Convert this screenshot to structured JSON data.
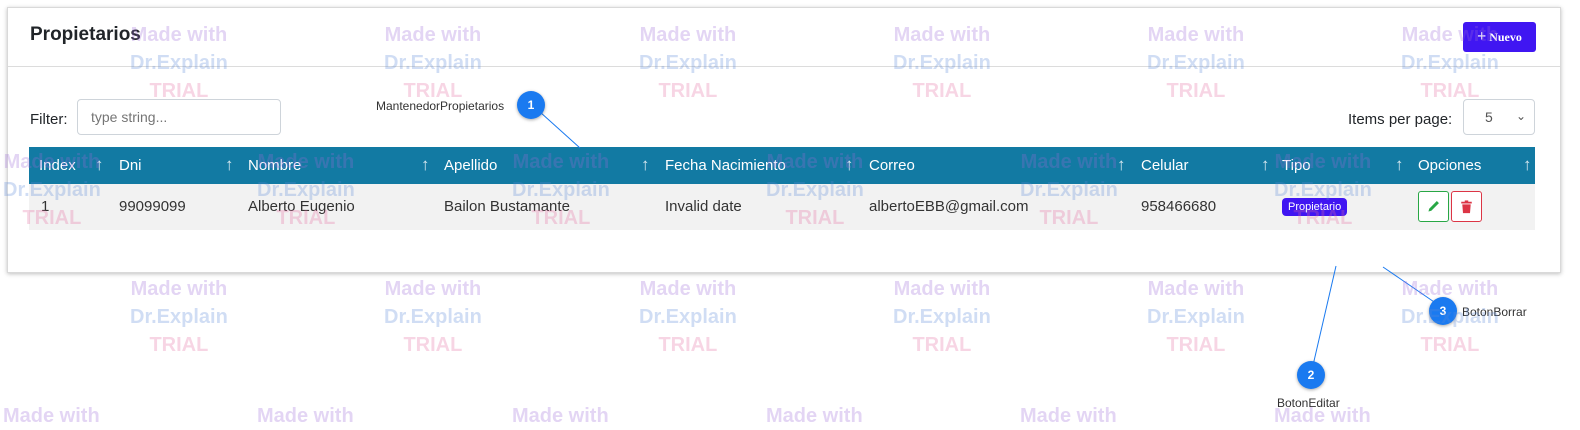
{
  "panel": {
    "title": "Propietarios",
    "new_button_label": "Nuevo",
    "new_button_icon": "plus-icon",
    "filter_label": "Filter:",
    "filter_placeholder": "type string...",
    "items_per_page_label": "Items per page:",
    "items_per_page_value": "5"
  },
  "table": {
    "columns": [
      "Index",
      "Dni",
      "Nombre",
      "Apellido",
      "Fecha Nacimiento",
      "Correo",
      "Celular",
      "Tipo",
      "Opciones"
    ],
    "sort_icon": "↑",
    "rows": [
      {
        "index": "1",
        "dni": "99099099",
        "nombre": "Alberto Eugenio",
        "apellido": "Bailon Bustamante",
        "fecha": "Invalid date",
        "correo": "albertoEBB@gmail.com",
        "celular": "958466680",
        "tipo": "Propietario"
      }
    ],
    "header_color": "#127aa3"
  },
  "callouts": [
    {
      "number": "1",
      "label": "MantenedorPropietarios"
    },
    {
      "number": "2",
      "label": "BotonEditar"
    },
    {
      "number": "3",
      "label": "BotonBorrar"
    }
  ],
  "watermark": {
    "line1": "Made with",
    "line2": "Dr.Explain",
    "line3": "TRIAL"
  },
  "colors": {
    "accent": "#4016f2",
    "header": "#127aa3",
    "edit": "#28a745",
    "delete": "#dc3545",
    "callout": "#1a7af0"
  }
}
